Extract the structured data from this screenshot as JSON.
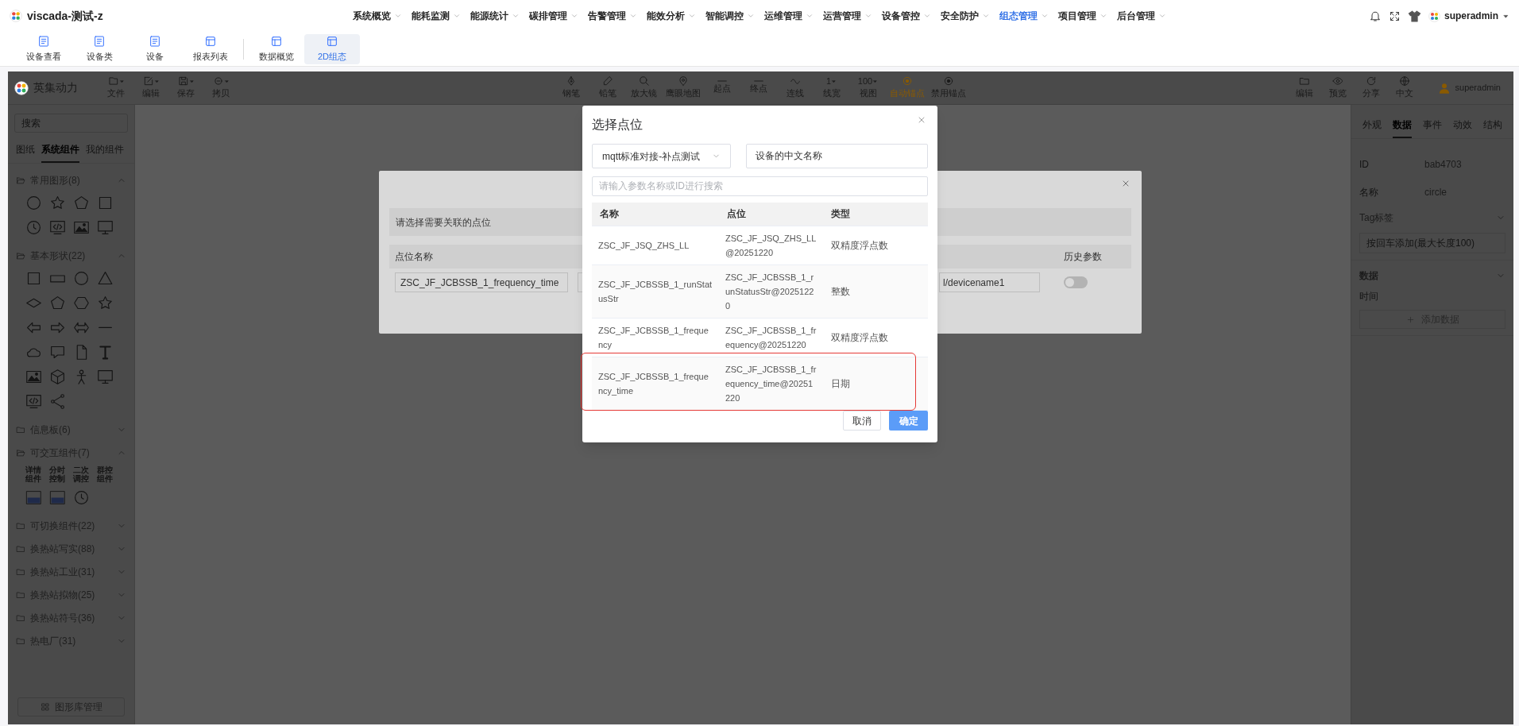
{
  "app": {
    "title": "viscada-测试-z"
  },
  "nav": [
    {
      "label": "系统概览",
      "selected": false
    },
    {
      "label": "能耗监测",
      "selected": false
    },
    {
      "label": "能源统计",
      "selected": false
    },
    {
      "label": "碳排管理",
      "selected": false
    },
    {
      "label": "告警管理",
      "selected": false
    },
    {
      "label": "能效分析",
      "selected": false
    },
    {
      "label": "智能调控",
      "selected": false
    },
    {
      "label": "运维管理",
      "selected": false
    },
    {
      "label": "运营管理",
      "selected": false
    },
    {
      "label": "设备管控",
      "selected": false
    },
    {
      "label": "安全防护",
      "selected": false
    },
    {
      "label": "组态管理",
      "selected": true
    },
    {
      "label": "项目管理",
      "selected": false
    },
    {
      "label": "后台管理",
      "selected": false
    }
  ],
  "user": {
    "name": "superadmin"
  },
  "subnav": [
    {
      "label": "设备查看",
      "selected": false
    },
    {
      "label": "设备类",
      "selected": false
    },
    {
      "label": "设备",
      "selected": false
    },
    {
      "label": "报表列表",
      "selected": false
    },
    {
      "label": "数据概览",
      "selected": false
    },
    {
      "label": "2D组态",
      "selected": true
    }
  ],
  "editor": {
    "brand": "英集动力",
    "file_tools": [
      "文件",
      "编辑",
      "保存",
      "拷贝"
    ],
    "draw_tools": [
      {
        "label": "钢笔",
        "active": false
      },
      {
        "label": "铅笔",
        "active": false
      },
      {
        "label": "放大镜",
        "active": false
      },
      {
        "label": "鹰眼地图",
        "active": false
      },
      {
        "label": "起点",
        "active": false
      },
      {
        "label": "终点",
        "active": false
      },
      {
        "label": "连线",
        "active": false
      },
      {
        "label": "线宽",
        "value": "1",
        "active": false
      },
      {
        "label": "视图",
        "value": "100",
        "active": false
      },
      {
        "label": "自动锚点",
        "active": true
      },
      {
        "label": "禁用锚点",
        "active": false
      }
    ],
    "right_tools": [
      "编辑",
      "预览",
      "分享",
      "中文"
    ],
    "user": "superadmin"
  },
  "sidebar": {
    "search_placeholder": "搜索",
    "tabs": [
      {
        "label": "图纸",
        "selected": false
      },
      {
        "label": "系统组件",
        "selected": true
      },
      {
        "label": "我的组件",
        "selected": false
      }
    ],
    "groups": [
      {
        "label": "常用图形(8)",
        "expanded": true
      },
      {
        "label": "基本形状(22)",
        "expanded": true
      },
      {
        "label": "信息板(6)",
        "expanded": false
      },
      {
        "label": "可交互组件(7)",
        "expanded": true,
        "tiles": [
          "详情组件",
          "分时控制",
          "二次调控",
          "群控组件"
        ]
      },
      {
        "label": "可切换组件(22)",
        "expanded": false
      },
      {
        "label": "换热站写实(88)",
        "expanded": false
      },
      {
        "label": "换热站工业(31)",
        "expanded": false
      },
      {
        "label": "换热站拟物(25)",
        "expanded": false
      },
      {
        "label": "换热站符号(36)",
        "expanded": false
      },
      {
        "label": "热电厂(31)",
        "expanded": false
      }
    ],
    "manage_button": "图形库管理"
  },
  "inspector": {
    "tabs": [
      {
        "label": "外观",
        "selected": false
      },
      {
        "label": "数据",
        "selected": true
      },
      {
        "label": "事件",
        "selected": false
      },
      {
        "label": "动效",
        "selected": false
      },
      {
        "label": "结构",
        "selected": false
      }
    ],
    "fields": [
      {
        "label": "ID",
        "value": "bab4703"
      },
      {
        "label": "名称",
        "value": "circle"
      }
    ],
    "tag_title": "Tag标签",
    "tag_placeholder": "按回车添加(最大长度100)",
    "data_title": "数据",
    "data_label": "时间",
    "add_button": "添加数据"
  },
  "link_dialog": {
    "hint": "请选择需要关联的点位",
    "columns": [
      "点位名称",
      "历史参数"
    ],
    "point_name": "ZSC_JF_JCBSSB_1_frequency_time",
    "device_path": "l/devicename1",
    "history": false
  },
  "point_picker": {
    "title": "选择点位",
    "device_select": "mqtt标准对接-补点测试",
    "device_name": "设备的中文名称",
    "search_placeholder": "请输入参数名称或ID进行搜索",
    "columns": [
      "名称",
      "点位",
      "类型"
    ],
    "rows": [
      {
        "name": "ZSC_JF_JSQ_ZHS_LL",
        "point": "ZSC_JF_JSQ_ZHS_LL@20251220",
        "type": "双精度浮点数",
        "highlighted": false
      },
      {
        "name": "ZSC_JF_JCBSSB_1_runStatusStr",
        "point": "ZSC_JF_JCBSSB_1_runStatusStr@20251220",
        "type": "整数",
        "highlighted": false
      },
      {
        "name": "ZSC_JF_JCBSSB_1_frequency",
        "point": "ZSC_JF_JCBSSB_1_frequency@20251220",
        "type": "双精度浮点数",
        "highlighted": false
      },
      {
        "name": "ZSC_JF_JCBSSB_1_frequency_time",
        "point": "ZSC_JF_JCBSSB_1_frequency_time@20251220",
        "type": "日期",
        "highlighted": true
      }
    ],
    "cancel": "取消",
    "confirm": "确定"
  }
}
